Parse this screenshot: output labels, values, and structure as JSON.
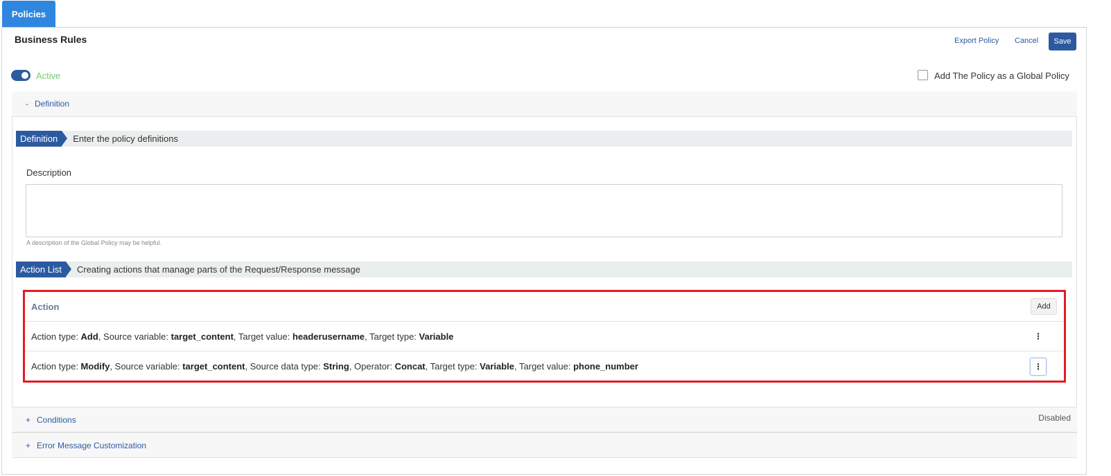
{
  "tab": {
    "label": "Policies"
  },
  "header": {
    "title": "Business Rules",
    "export_label": "Export Policy",
    "cancel_label": "Cancel",
    "save_label": "Save"
  },
  "status": {
    "active": true,
    "active_label": "Active"
  },
  "global_policy": {
    "checked": false,
    "label": "Add The Policy as a Global Policy"
  },
  "definition_panel": {
    "toggle_sign": "-",
    "title": "Definition",
    "section_badge": "Definition",
    "section_desc": "Enter the policy definitions",
    "description_label": "Description",
    "description_value": "",
    "description_hint": "A description of the Global Policy may be helpful.",
    "action_badge": "Action List",
    "action_desc": "Creating actions that manage parts of the Request/Response message"
  },
  "action_list": {
    "header": "Action",
    "add_label": "Add",
    "rows": [
      [
        {
          "t": "Action type: "
        },
        {
          "b": "Add"
        },
        {
          "t": ", Source variable: "
        },
        {
          "b": "target_content"
        },
        {
          "t": ", Target value: "
        },
        {
          "b": "headerusername"
        },
        {
          "t": ", Target type: "
        },
        {
          "b": "Variable"
        }
      ],
      [
        {
          "t": "Action type: "
        },
        {
          "b": "Modify"
        },
        {
          "t": ", Source variable: "
        },
        {
          "b": "target_content"
        },
        {
          "t": ", Source data type: "
        },
        {
          "b": "String"
        },
        {
          "t": ", Operator: "
        },
        {
          "b": "Concat"
        },
        {
          "t": ", Target type: "
        },
        {
          "b": "Variable"
        },
        {
          "t": ", Target value: "
        },
        {
          "b": "phone_number"
        }
      ]
    ],
    "menu_icon": "kebab-icon",
    "menu_glyph": "⋮"
  },
  "conditions_panel": {
    "toggle_sign": "+",
    "title": "Conditions",
    "status": "Disabled"
  },
  "error_panel": {
    "toggle_sign": "+",
    "title": "Error Message Customization"
  },
  "colors": {
    "accent": "#2c5aa0",
    "tab": "#2e86de",
    "active_text": "#7cc576",
    "highlight": "#e21b24"
  }
}
